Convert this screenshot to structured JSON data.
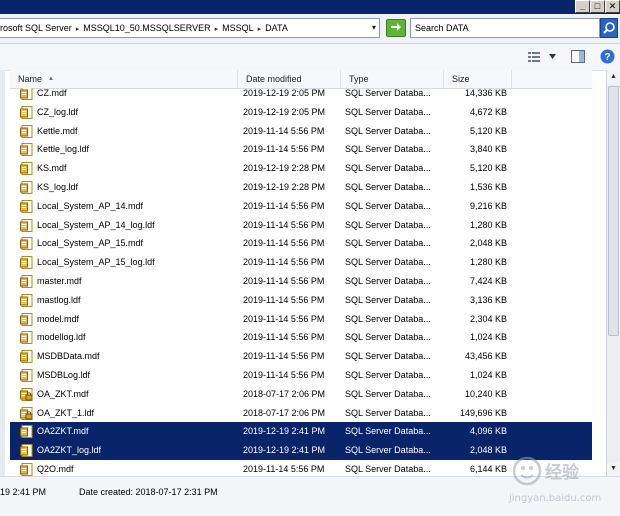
{
  "address": {
    "crumbs": [
      "rosoft SQL Server",
      "MSSQL10_50.MSSQLSERVER",
      "MSSQL",
      "DATA"
    ],
    "separator": "▸",
    "dropdown_glyph": "▾"
  },
  "search": {
    "placeholder": "Search DATA"
  },
  "columns": {
    "name": "Name",
    "date": "Date modified",
    "type": "Type",
    "size": "Size"
  },
  "files": [
    {
      "name": "CZ.mdf",
      "date": "2019-12-19 2:05 PM",
      "type": "SQL Server Databa...",
      "size": "14,336 KB",
      "selected": false,
      "icon": "mdf-file-icon"
    },
    {
      "name": "CZ_log.ldf",
      "date": "2019-12-19 2:05 PM",
      "type": "SQL Server Databa...",
      "size": "4,672 KB",
      "selected": false,
      "icon": "ldf-file-icon"
    },
    {
      "name": "Kettle.mdf",
      "date": "2019-11-14 5:56 PM",
      "type": "SQL Server Databa...",
      "size": "5,120 KB",
      "selected": false,
      "icon": "mdf-file-icon"
    },
    {
      "name": "Kettle_log.ldf",
      "date": "2019-11-14 5:56 PM",
      "type": "SQL Server Databa...",
      "size": "3,840 KB",
      "selected": false,
      "icon": "ldf-file-icon"
    },
    {
      "name": "KS.mdf",
      "date": "2019-12-19 2:28 PM",
      "type": "SQL Server Databa...",
      "size": "5,120 KB",
      "selected": false,
      "icon": "mdf-file-icon"
    },
    {
      "name": "KS_log.ldf",
      "date": "2019-12-19 2:28 PM",
      "type": "SQL Server Databa...",
      "size": "1,536 KB",
      "selected": false,
      "icon": "ldf-file-icon"
    },
    {
      "name": "Local_System_AP_14.mdf",
      "date": "2019-11-14 5:56 PM",
      "type": "SQL Server Databa...",
      "size": "9,216 KB",
      "selected": false,
      "icon": "mdf-file-icon"
    },
    {
      "name": "Local_System_AP_14_log.ldf",
      "date": "2019-11-14 5:56 PM",
      "type": "SQL Server Databa...",
      "size": "1,280 KB",
      "selected": false,
      "icon": "ldf-file-icon"
    },
    {
      "name": "Local_System_AP_15.mdf",
      "date": "2019-11-14 5:56 PM",
      "type": "SQL Server Databa...",
      "size": "2,048 KB",
      "selected": false,
      "icon": "mdf-file-icon"
    },
    {
      "name": "Local_System_AP_15_log.ldf",
      "date": "2019-11-14 5:56 PM",
      "type": "SQL Server Databa...",
      "size": "1,280 KB",
      "selected": false,
      "icon": "ldf-file-icon"
    },
    {
      "name": "master.mdf",
      "date": "2019-11-14 5:56 PM",
      "type": "SQL Server Databa...",
      "size": "7,424 KB",
      "selected": false,
      "icon": "mdf-file-icon"
    },
    {
      "name": "mastlog.ldf",
      "date": "2019-11-14 5:56 PM",
      "type": "SQL Server Databa...",
      "size": "3,136 KB",
      "selected": false,
      "icon": "ldf-file-icon"
    },
    {
      "name": "model.mdf",
      "date": "2019-11-14 5:56 PM",
      "type": "SQL Server Databa...",
      "size": "2,304 KB",
      "selected": false,
      "icon": "mdf-file-icon"
    },
    {
      "name": "modellog.ldf",
      "date": "2019-11-14 5:56 PM",
      "type": "SQL Server Databa...",
      "size": "1,024 KB",
      "selected": false,
      "icon": "ldf-file-icon"
    },
    {
      "name": "MSDBData.mdf",
      "date": "2019-11-14 5:56 PM",
      "type": "SQL Server Databa...",
      "size": "43,456 KB",
      "selected": false,
      "icon": "mdf-file-icon"
    },
    {
      "name": "MSDBLog.ldf",
      "date": "2019-11-14 5:56 PM",
      "type": "SQL Server Databa...",
      "size": "1,024 KB",
      "selected": false,
      "icon": "ldf-file-icon"
    },
    {
      "name": "OA_ZKT.mdf",
      "date": "2018-07-17 2:06 PM",
      "type": "SQL Server Databa...",
      "size": "10,240 KB",
      "selected": false,
      "icon": "locked-mdf-file-icon"
    },
    {
      "name": "OA_ZKT_1.ldf",
      "date": "2018-07-17 2:06 PM",
      "type": "SQL Server Databa...",
      "size": "149,696 KB",
      "selected": false,
      "icon": "locked-ldf-file-icon"
    },
    {
      "name": "OA2ZKT.mdf",
      "date": "2019-12-19 2:41 PM",
      "type": "SQL Server Databa...",
      "size": "4,096 KB",
      "selected": true,
      "icon": "mdf-file-icon"
    },
    {
      "name": "OA2ZKT_log.ldf",
      "date": "2019-12-19 2:41 PM",
      "type": "SQL Server Databa...",
      "size": "2,048 KB",
      "selected": true,
      "icon": "ldf-file-icon"
    },
    {
      "name": "Q2O.mdf",
      "date": "2019-11-14 5:56 PM",
      "type": "SQL Server Databa...",
      "size": "6,144 KB",
      "selected": false,
      "icon": "mdf-file-icon"
    }
  ],
  "details": {
    "modified": "19 2:41 PM",
    "created": "Date created: 2018-07-17 2:31 PM"
  },
  "watermark": {
    "line1": "Baidu 经验",
    "line2": "jingyan.baidu.com"
  },
  "colors": {
    "selection": "#0a246a",
    "titlebar": "#0a246a",
    "refresh": "#5fb336",
    "search_button": "#2a64c0"
  }
}
